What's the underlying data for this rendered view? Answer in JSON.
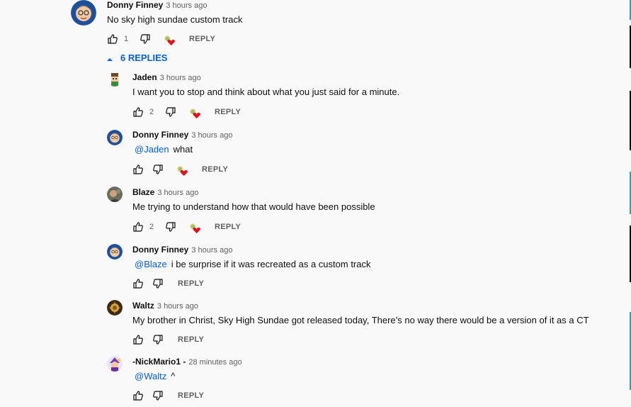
{
  "top_comment": {
    "author": "Donny Finney",
    "time": "3 hours ago",
    "text": "No sky high sundae custom track",
    "likes": "1",
    "reply_label": "REPLY"
  },
  "replies_toggle": {
    "label": "6 REPLIES"
  },
  "replies": [
    {
      "author": "Jaden",
      "time": "3 hours ago",
      "mention": "",
      "text": "I want you to stop and think about what you just said for a minute.",
      "likes": "2",
      "reply_label": "REPLY"
    },
    {
      "author": "Donny Finney",
      "time": "3 hours ago",
      "mention": "@Jaden",
      "text": "what",
      "likes": "",
      "reply_label": "REPLY"
    },
    {
      "author": "Blaze",
      "time": "3 hours ago",
      "mention": "",
      "text": "Me trying to understand how that would have been possible",
      "likes": "2",
      "reply_label": "REPLY"
    },
    {
      "author": "Donny Finney",
      "time": "3 hours ago",
      "mention": "@Blaze",
      "text": "i be surprise if it was recreated as a custom track",
      "likes": "",
      "reply_label": "REPLY"
    },
    {
      "author": "Waltz",
      "time": "3 hours ago",
      "mention": "",
      "text": "My brother in Christ, Sky High Sundae got released today, There’s no way there would be a version of it as a CT",
      "likes": "",
      "reply_label": "REPLY"
    },
    {
      "author": "-NickMario1 -",
      "time": "28 minutes ago",
      "mention": "@Waltz",
      "text": "^",
      "likes": "",
      "reply_label": "REPLY"
    }
  ],
  "colors": {
    "link_blue": "#065fd4",
    "heart_red": "#e0141e",
    "background": "#f9f9f9"
  }
}
